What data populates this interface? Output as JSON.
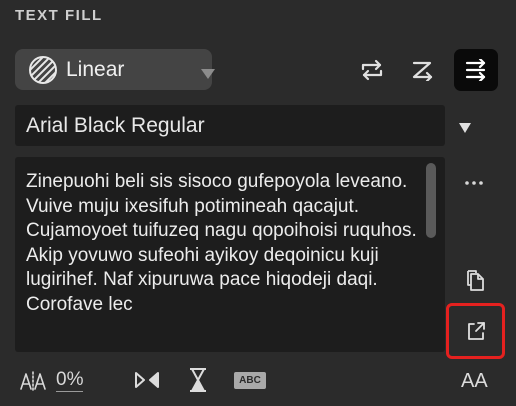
{
  "section": {
    "title": "TEXT FILL"
  },
  "fill_type": {
    "selected": "Linear",
    "icon": "diagonal-stripes-icon"
  },
  "direction_buttons": [
    {
      "icon": "swap-horizontal-icon",
      "active": false
    },
    {
      "icon": "z-swap-icon",
      "active": false
    },
    {
      "icon": "align-lines-swap-icon",
      "active": true
    }
  ],
  "font": {
    "value": "Arial Black Regular"
  },
  "text": {
    "content": "Zinepuohi beli sis sisoco gufepoyola leveano. Vuive muju ixesifuh potimineah qacajut. Cujamoyoet tuifuzeq nagu qopoihoisi ruquhos. Akip yovuwo sufeohi ayikoy deqoinicu kuji lugirihef. Naf xipuruwa pace hiqodeji daqi. Corofave lec"
  },
  "side_actions": [
    {
      "icon": "more-horizontal-icon"
    },
    {
      "icon": "copy-document-icon"
    },
    {
      "icon": "export-share-icon",
      "highlighted": true
    }
  ],
  "bottom_bar": {
    "tracking_percent": "0%",
    "abc_label": "ABC",
    "case_label": "AA"
  },
  "colors": {
    "background": "#2b2b2b",
    "field": "#1d1d1d",
    "select": "#444444",
    "highlight": "#e5211f"
  }
}
